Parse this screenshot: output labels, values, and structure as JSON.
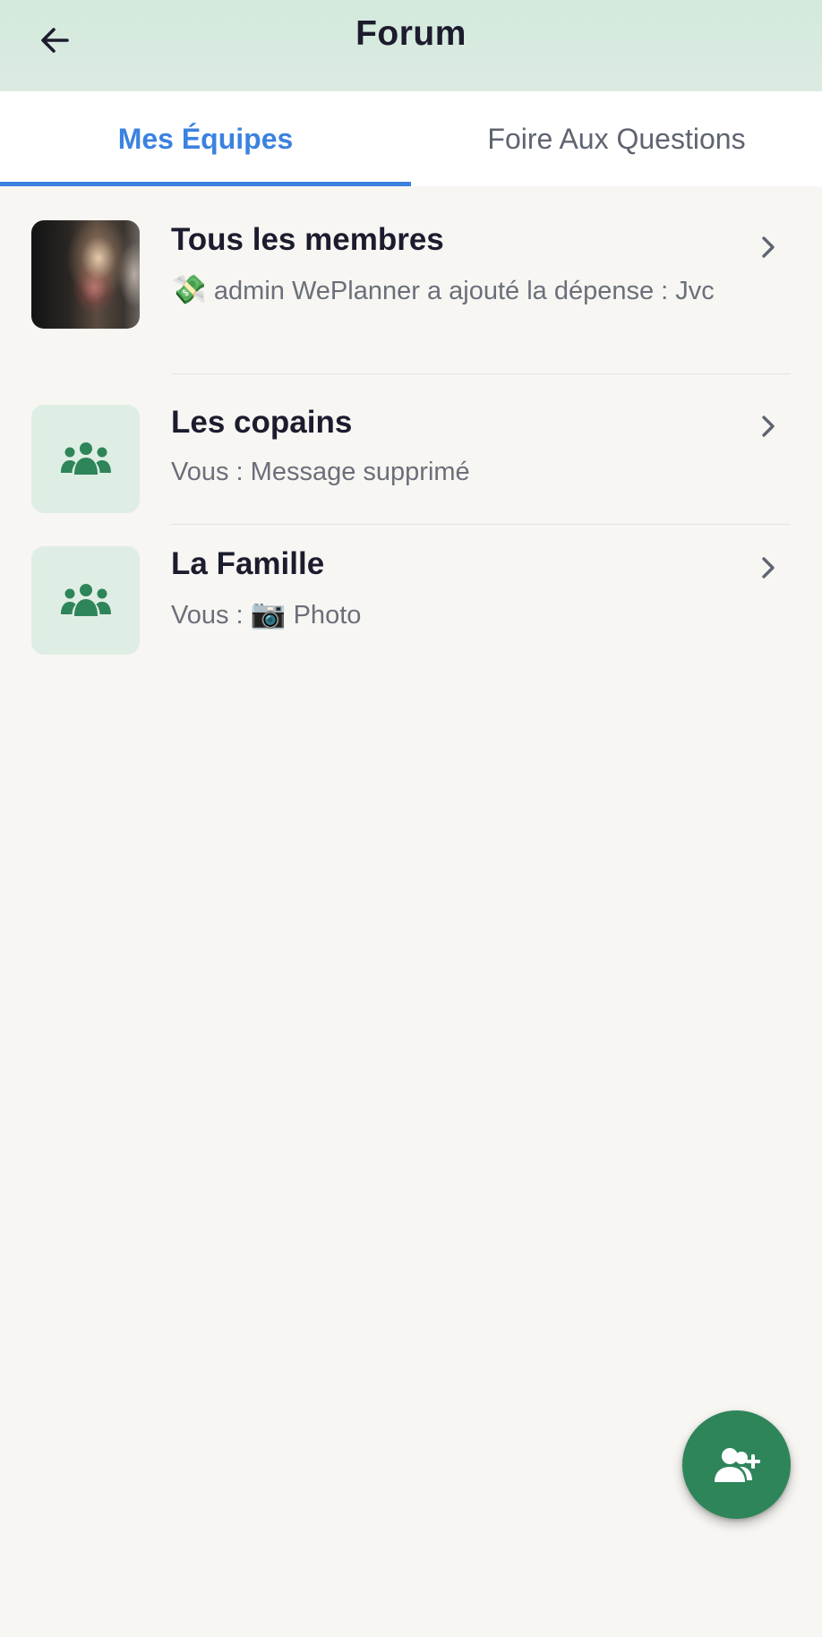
{
  "header": {
    "title": "Forum",
    "back_icon": "arrow-left-icon"
  },
  "tabs": [
    {
      "label": "Mes Équipes",
      "active": true
    },
    {
      "label": "Foire Aux Questions",
      "active": false
    }
  ],
  "teams": [
    {
      "name": "Tous les membres",
      "avatar": "photo",
      "last_message_emoji": "💸",
      "last_message": "admin WePlanner a ajouté la dépense : Jvc"
    },
    {
      "name": "Les copains",
      "avatar": "group-icon",
      "last_message_emoji": "",
      "last_message": "Vous : Message supprimé"
    },
    {
      "name": "La Famille",
      "avatar": "group-icon",
      "last_message_prefix": "Vous :",
      "last_message_emoji": "📷",
      "last_message": "Photo"
    }
  ],
  "fab": {
    "icon": "add-user-icon"
  },
  "colors": {
    "header_bg": "#d3e9dc",
    "accent_blue": "#3b82e0",
    "brand_green": "#2e8559",
    "group_avatar_bg": "#dfeee4",
    "page_bg": "#f7f6f3"
  }
}
